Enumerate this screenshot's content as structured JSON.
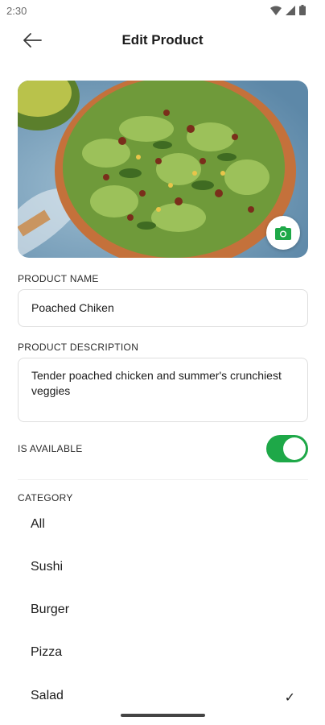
{
  "status_bar": {
    "time": "2:30"
  },
  "header": {
    "title": "Edit Product"
  },
  "product": {
    "name_label": "PRODUCT NAME",
    "name_value": "Poached Chiken",
    "description_label": "PRODUCT DESCRIPTION",
    "description_value": "Tender poached chicken and summer's crunchiest veggies",
    "available_label": "IS AVAILABLE",
    "is_available": true
  },
  "category": {
    "label": "CATEGORY",
    "items": [
      {
        "label": "All",
        "selected": false
      },
      {
        "label": "Sushi",
        "selected": false
      },
      {
        "label": "Burger",
        "selected": false
      },
      {
        "label": "Pizza",
        "selected": false
      },
      {
        "label": "Salad",
        "selected": true
      }
    ],
    "check_glyph": "✓"
  },
  "colors": {
    "accent": "#1ea848",
    "text": "#1c1c1c",
    "border": "#dedede"
  },
  "icons": {
    "back": "arrow-left-icon",
    "camera": "camera-icon",
    "wifi": "wifi-icon",
    "signal": "signal-icon",
    "battery": "battery-icon",
    "check": "check-icon"
  }
}
